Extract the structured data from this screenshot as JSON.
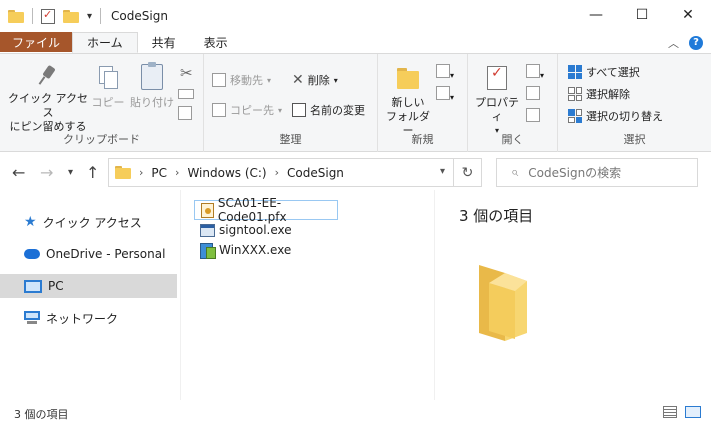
{
  "window": {
    "title": "CodeSign",
    "minimize": "—",
    "maximize": "☐",
    "close": "✕"
  },
  "ribbon_tabs": [
    "ファイル",
    "ホーム",
    "共有",
    "表示"
  ],
  "ribbon": {
    "clipboard": {
      "label": "クリップボード",
      "pin_line1": "クイック アクセス",
      "pin_line2": "にピン留めする",
      "copy": "コピー",
      "paste": "貼り付け"
    },
    "organize": {
      "label": "整理",
      "move_to": "移動先",
      "copy_to": "コピー先",
      "delete": "削除",
      "rename": "名前の変更"
    },
    "new": {
      "label": "新規",
      "new_folder_line1": "新しい",
      "new_folder_line2": "フォルダー"
    },
    "open": {
      "label": "開く",
      "properties": "プロパティ"
    },
    "select": {
      "label": "選択",
      "select_all": "すべて選択",
      "select_none": "選択解除",
      "invert": "選択の切り替え"
    }
  },
  "address": {
    "segments": [
      "PC",
      "Windows (C:)",
      "CodeSign"
    ],
    "search_placeholder": "CodeSignの検索"
  },
  "nav": [
    {
      "label": "クイック アクセス",
      "icon": "star-icon"
    },
    {
      "label": "OneDrive - Personal",
      "icon": "cloud-icon"
    },
    {
      "label": "PC",
      "icon": "pc-icon",
      "selected": true
    },
    {
      "label": "ネットワーク",
      "icon": "network-icon"
    }
  ],
  "files": [
    {
      "name": "SCA01-EE-Code01.pfx",
      "icon": "certificate-icon"
    },
    {
      "name": "signtool.exe",
      "icon": "exe-icon"
    },
    {
      "name": "WinXXX.exe",
      "icon": "installer-icon"
    }
  ],
  "preview": {
    "count": "3 個の項目"
  },
  "status": {
    "count": "3 個の項目"
  },
  "colors": {
    "file_tab": "#a6562b",
    "accent": "#2b7bd1",
    "folder": "#f6cd5a"
  }
}
